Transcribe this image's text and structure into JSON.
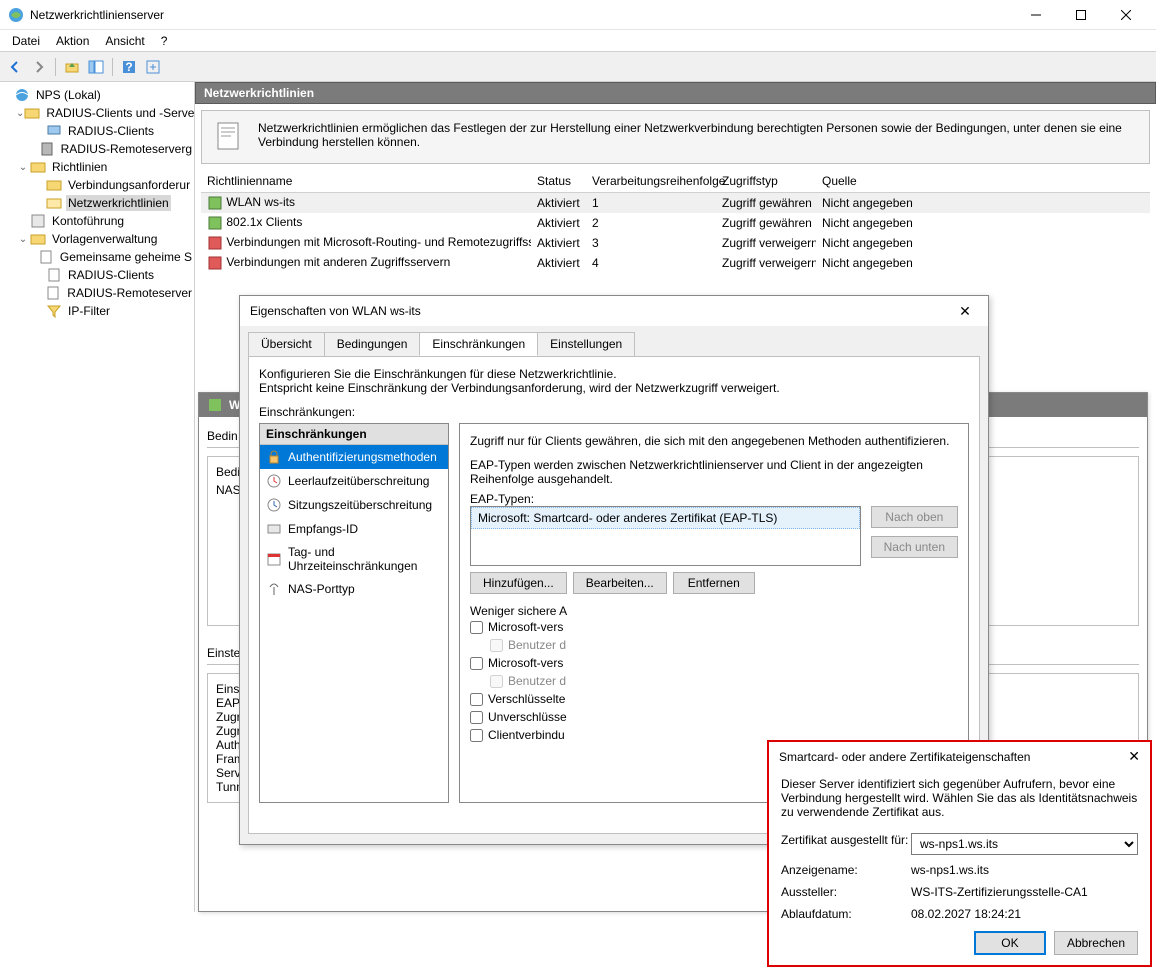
{
  "window": {
    "title": "Netzwerkrichtlinienserver"
  },
  "menu": {
    "items": [
      "Datei",
      "Aktion",
      "Ansicht",
      "?"
    ]
  },
  "tree": {
    "root": "NPS (Lokal)",
    "n0": "RADIUS-Clients und -Serve",
    "n0_0": "RADIUS-Clients",
    "n0_1": "RADIUS-Remoteserverg",
    "n1": "Richtlinien",
    "n1_0": "Verbindungsanforderur",
    "n1_1": "Netzwerkrichtlinien",
    "n2": "Kontoführung",
    "n3": "Vorlagenverwaltung",
    "n3_0": "Gemeinsame geheime S",
    "n3_1": "RADIUS-Clients",
    "n3_2": "RADIUS-Remoteserver",
    "n3_3": "IP-Filter"
  },
  "content": {
    "header": "Netzwerkrichtlinien",
    "info": "Netzwerkrichtlinien ermöglichen das Festlegen der zur Herstellung einer Netzwerkverbindung berechtigten Personen sowie der Bedingungen, unter denen sie eine Verbindung herstellen können."
  },
  "policies": {
    "cols": {
      "c0": "Richtlinienname",
      "c1": "Status",
      "c2": "Verarbeitungsreihenfolge",
      "c3": "Zugriffstyp",
      "c4": "Quelle"
    },
    "rows": [
      {
        "name": "WLAN ws-its",
        "status": "Aktiviert",
        "order": "1",
        "access": "Zugriff gewähren",
        "source": "Nicht angegeben"
      },
      {
        "name": "802.1x Clients",
        "status": "Aktiviert",
        "order": "2",
        "access": "Zugriff gewähren",
        "source": "Nicht angegeben"
      },
      {
        "name": "Verbindungen mit Microsoft-Routing- und Remotezugriffsserver",
        "status": "Aktiviert",
        "order": "3",
        "access": "Zugriff verweigern",
        "source": "Nicht angegeben"
      },
      {
        "name": "Verbindungen mit anderen Zugriffsservern",
        "status": "Aktiviert",
        "order": "4",
        "access": "Zugriff verweigern",
        "source": "Nicht angegeben"
      }
    ]
  },
  "bg": {
    "wl_header": "WL",
    "bedin_label": "Bedin",
    "bedi": "Bedi",
    "nas": "NAS",
    "einst_tab": "Einste",
    "einst": "Einst",
    "eap": "EAP",
    "zugr": "Zugr",
    "zugr2": "Zugr",
    "auth": "Auth",
    "fram": "Fram",
    "serv": "Serv",
    "tunn": "Tunn"
  },
  "prop": {
    "title": "Eigenschaften von WLAN ws-its",
    "tabs": {
      "t0": "Übersicht",
      "t1": "Bedingungen",
      "t2": "Einschränkungen",
      "t3": "Einstellungen"
    },
    "desc1": "Konfigurieren Sie die Einschränkungen für diese Netzwerkrichtlinie.",
    "desc2": "Entspricht keine Einschränkung der Verbindungsanforderung, wird der Netzwerkzugriff verweigert.",
    "constraints_label": "Einschränkungen:",
    "constraints_header": "Einschränkungen",
    "items": {
      "i0": "Authentifizierungsmethoden",
      "i1": "Leerlaufzeitüberschreitung",
      "i2": "Sitzungszeitüberschreitung",
      "i3": "Empfangs-ID",
      "i4": "Tag- und Uhrzeiteinschränkungen",
      "i5": "NAS-Porttyp"
    },
    "detail": {
      "d1": "Zugriff nur für Clients gewähren, die sich mit den angegebenen Methoden authentifizieren.",
      "d2": "EAP-Typen werden zwischen Netzwerkrichtlinienserver und Client in der angezeigten Reihenfolge ausgehandelt.",
      "eap_label": "EAP-Typen:",
      "eap_item": "Microsoft: Smartcard- oder anderes Zertifikat (EAP-TLS)",
      "up": "Nach oben",
      "down": "Nach unten",
      "add": "Hinzufügen...",
      "edit": "Bearbeiten...",
      "remove": "Entfernen",
      "less_secure": "Weniger sichere A",
      "c0": "Microsoft-vers",
      "c0a": "Benutzer d",
      "c1": "Microsoft-vers",
      "c1a": "Benutzer d",
      "c2": "Verschlüsselte",
      "c3": "Unverschlüsse",
      "c4": "Clientverbindu"
    }
  },
  "cert": {
    "title": "Smartcard- oder andere Zertifikateigenschaften",
    "desc": "Dieser Server identifiziert sich gegenüber Aufrufern, bevor eine Verbindung hergestellt wird. Wählen Sie das als Identitätsnachweis zu verwendende Zertifikat aus.",
    "issued_for_label": "Zertifikat ausgestellt für:",
    "issued_for": "ws-nps1.ws.its",
    "display_name_label": "Anzeigename:",
    "display_name": "ws-nps1.ws.its",
    "issuer_label": "Aussteller:",
    "issuer": "WS-ITS-Zertifizierungsstelle-CA1",
    "expiry_label": "Ablaufdatum:",
    "expiry": "08.02.2027 18:24:21",
    "ok": "OK",
    "cancel": "Abbrechen"
  }
}
